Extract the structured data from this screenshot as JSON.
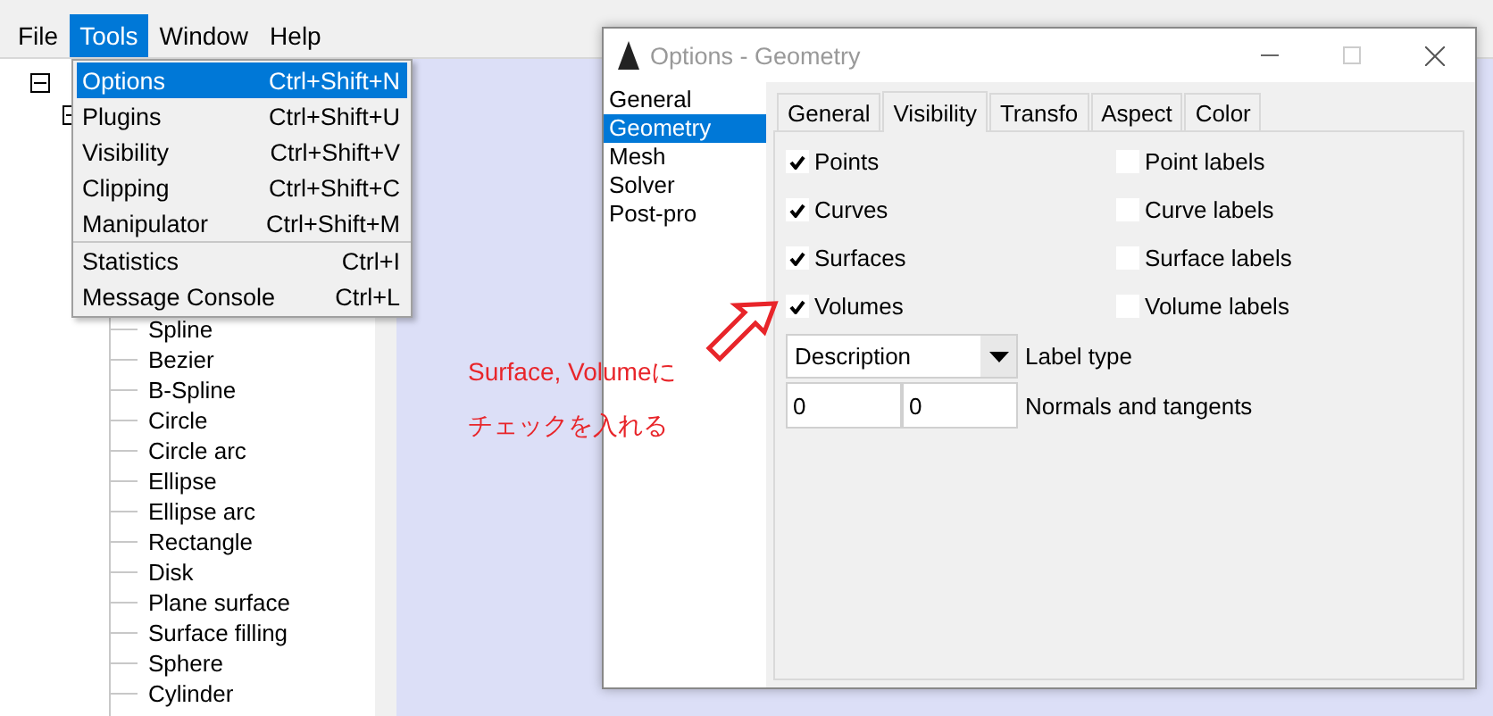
{
  "menubar": [
    {
      "label": "File",
      "selected": false
    },
    {
      "label": "Tools",
      "selected": true
    },
    {
      "label": "Window",
      "selected": false
    },
    {
      "label": "Help",
      "selected": false
    }
  ],
  "tools_menu": {
    "groups": [
      [
        {
          "label": "Options",
          "shortcut": "Ctrl+Shift+N",
          "selected": true
        },
        {
          "label": "Plugins",
          "shortcut": "Ctrl+Shift+U",
          "selected": false
        },
        {
          "label": "Visibility",
          "shortcut": "Ctrl+Shift+V",
          "selected": false
        },
        {
          "label": "Clipping",
          "shortcut": "Ctrl+Shift+C",
          "selected": false
        },
        {
          "label": "Manipulator",
          "shortcut": "Ctrl+Shift+M",
          "selected": false
        }
      ],
      [
        {
          "label": "Statistics",
          "shortcut": "Ctrl+I",
          "selected": false
        },
        {
          "label": "Message Console",
          "shortcut": "Ctrl+L",
          "selected": false
        }
      ]
    ]
  },
  "tree": {
    "root": {
      "expanded": true
    },
    "leaves": [
      "Spline",
      "Bezier",
      "B-Spline",
      "Circle",
      "Circle arc",
      "Ellipse",
      "Ellipse arc",
      "Rectangle",
      "Disk",
      "Plane surface",
      "Surface filling",
      "Sphere",
      "Cylinder"
    ]
  },
  "dialog": {
    "title": "Options - Geometry",
    "categories": [
      {
        "label": "General",
        "selected": false
      },
      {
        "label": "Geometry",
        "selected": true
      },
      {
        "label": "Mesh",
        "selected": false
      },
      {
        "label": "Solver",
        "selected": false
      },
      {
        "label": "Post-pro",
        "selected": false
      }
    ],
    "tabs": [
      {
        "label": "General",
        "selected": false
      },
      {
        "label": "Visibility",
        "selected": true
      },
      {
        "label": "Transfo",
        "selected": false
      },
      {
        "label": "Aspect",
        "selected": false
      },
      {
        "label": "Color",
        "selected": false
      }
    ],
    "checkboxes": [
      [
        {
          "label": "Points",
          "checked": true
        },
        {
          "label": "Point labels",
          "checked": false
        }
      ],
      [
        {
          "label": "Curves",
          "checked": true
        },
        {
          "label": "Curve labels",
          "checked": false
        }
      ],
      [
        {
          "label": "Surfaces",
          "checked": true
        },
        {
          "label": "Surface labels",
          "checked": false
        }
      ],
      [
        {
          "label": "Volumes",
          "checked": true
        },
        {
          "label": "Volume labels",
          "checked": false
        }
      ]
    ],
    "label_type": {
      "value": "Description",
      "label": "Label type"
    },
    "normals": {
      "values": [
        "0",
        "0"
      ],
      "label": "Normals and tangents"
    }
  },
  "annotation": {
    "lines": [
      "Surface, Volumeに",
      "チェックを入れる"
    ]
  }
}
